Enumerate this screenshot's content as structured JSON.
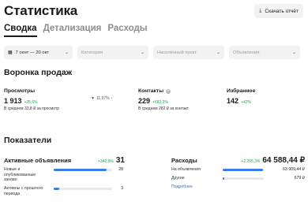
{
  "header": {
    "title": "Статистика",
    "export_label": "Скачать отчёт"
  },
  "tabs": [
    {
      "label": "Сводка",
      "active": true
    },
    {
      "label": "Детализация",
      "active": false
    },
    {
      "label": "Расходы",
      "active": false
    }
  ],
  "filters": {
    "date": "7 сент — 20 окт",
    "category_placeholder": "Категория",
    "city_placeholder": "Населённый пункт",
    "ads_placeholder": "Объявления"
  },
  "funnel": {
    "title": "Воронка продаж",
    "views": {
      "label": "Просмотры",
      "value": "1 913",
      "delta": "+25,6%",
      "sub": "В среднем 33,8 ₽ за просмотр"
    },
    "conversion": "11,97%",
    "contacts": {
      "label": "Контакты",
      "value": "229",
      "delta": "+683,3%",
      "sub": "В среднем 282 ₽ за контакт"
    },
    "favorites": {
      "label": "Избранное",
      "value": "142",
      "delta": "+42%"
    }
  },
  "indicators": {
    "title": "Показатели",
    "active_ads": {
      "label": "Активные объявления",
      "delta": "+342,9%",
      "value": "31",
      "rows": [
        {
          "label": "Новые и опубликованные заново",
          "value": "28",
          "fraction": 0.9
        },
        {
          "label": "Активны с прошлого периода",
          "value": "3",
          "fraction": 0.1
        }
      ]
    },
    "expenses": {
      "label": "Расходы",
      "delta": "+2 295,3%",
      "value": "64 588,44 ₽",
      "rows": [
        {
          "label": "На объявления",
          "value": "63 909,44 ₽",
          "fraction": 0.99
        },
        {
          "label": "Другие",
          "value": "679 ₽",
          "fraction": 0.03
        }
      ],
      "more_label": "Подробнее"
    }
  },
  "colors": {
    "accent": "#3d7be8",
    "positive": "#1fa54a",
    "link": "#2f6fd6"
  }
}
